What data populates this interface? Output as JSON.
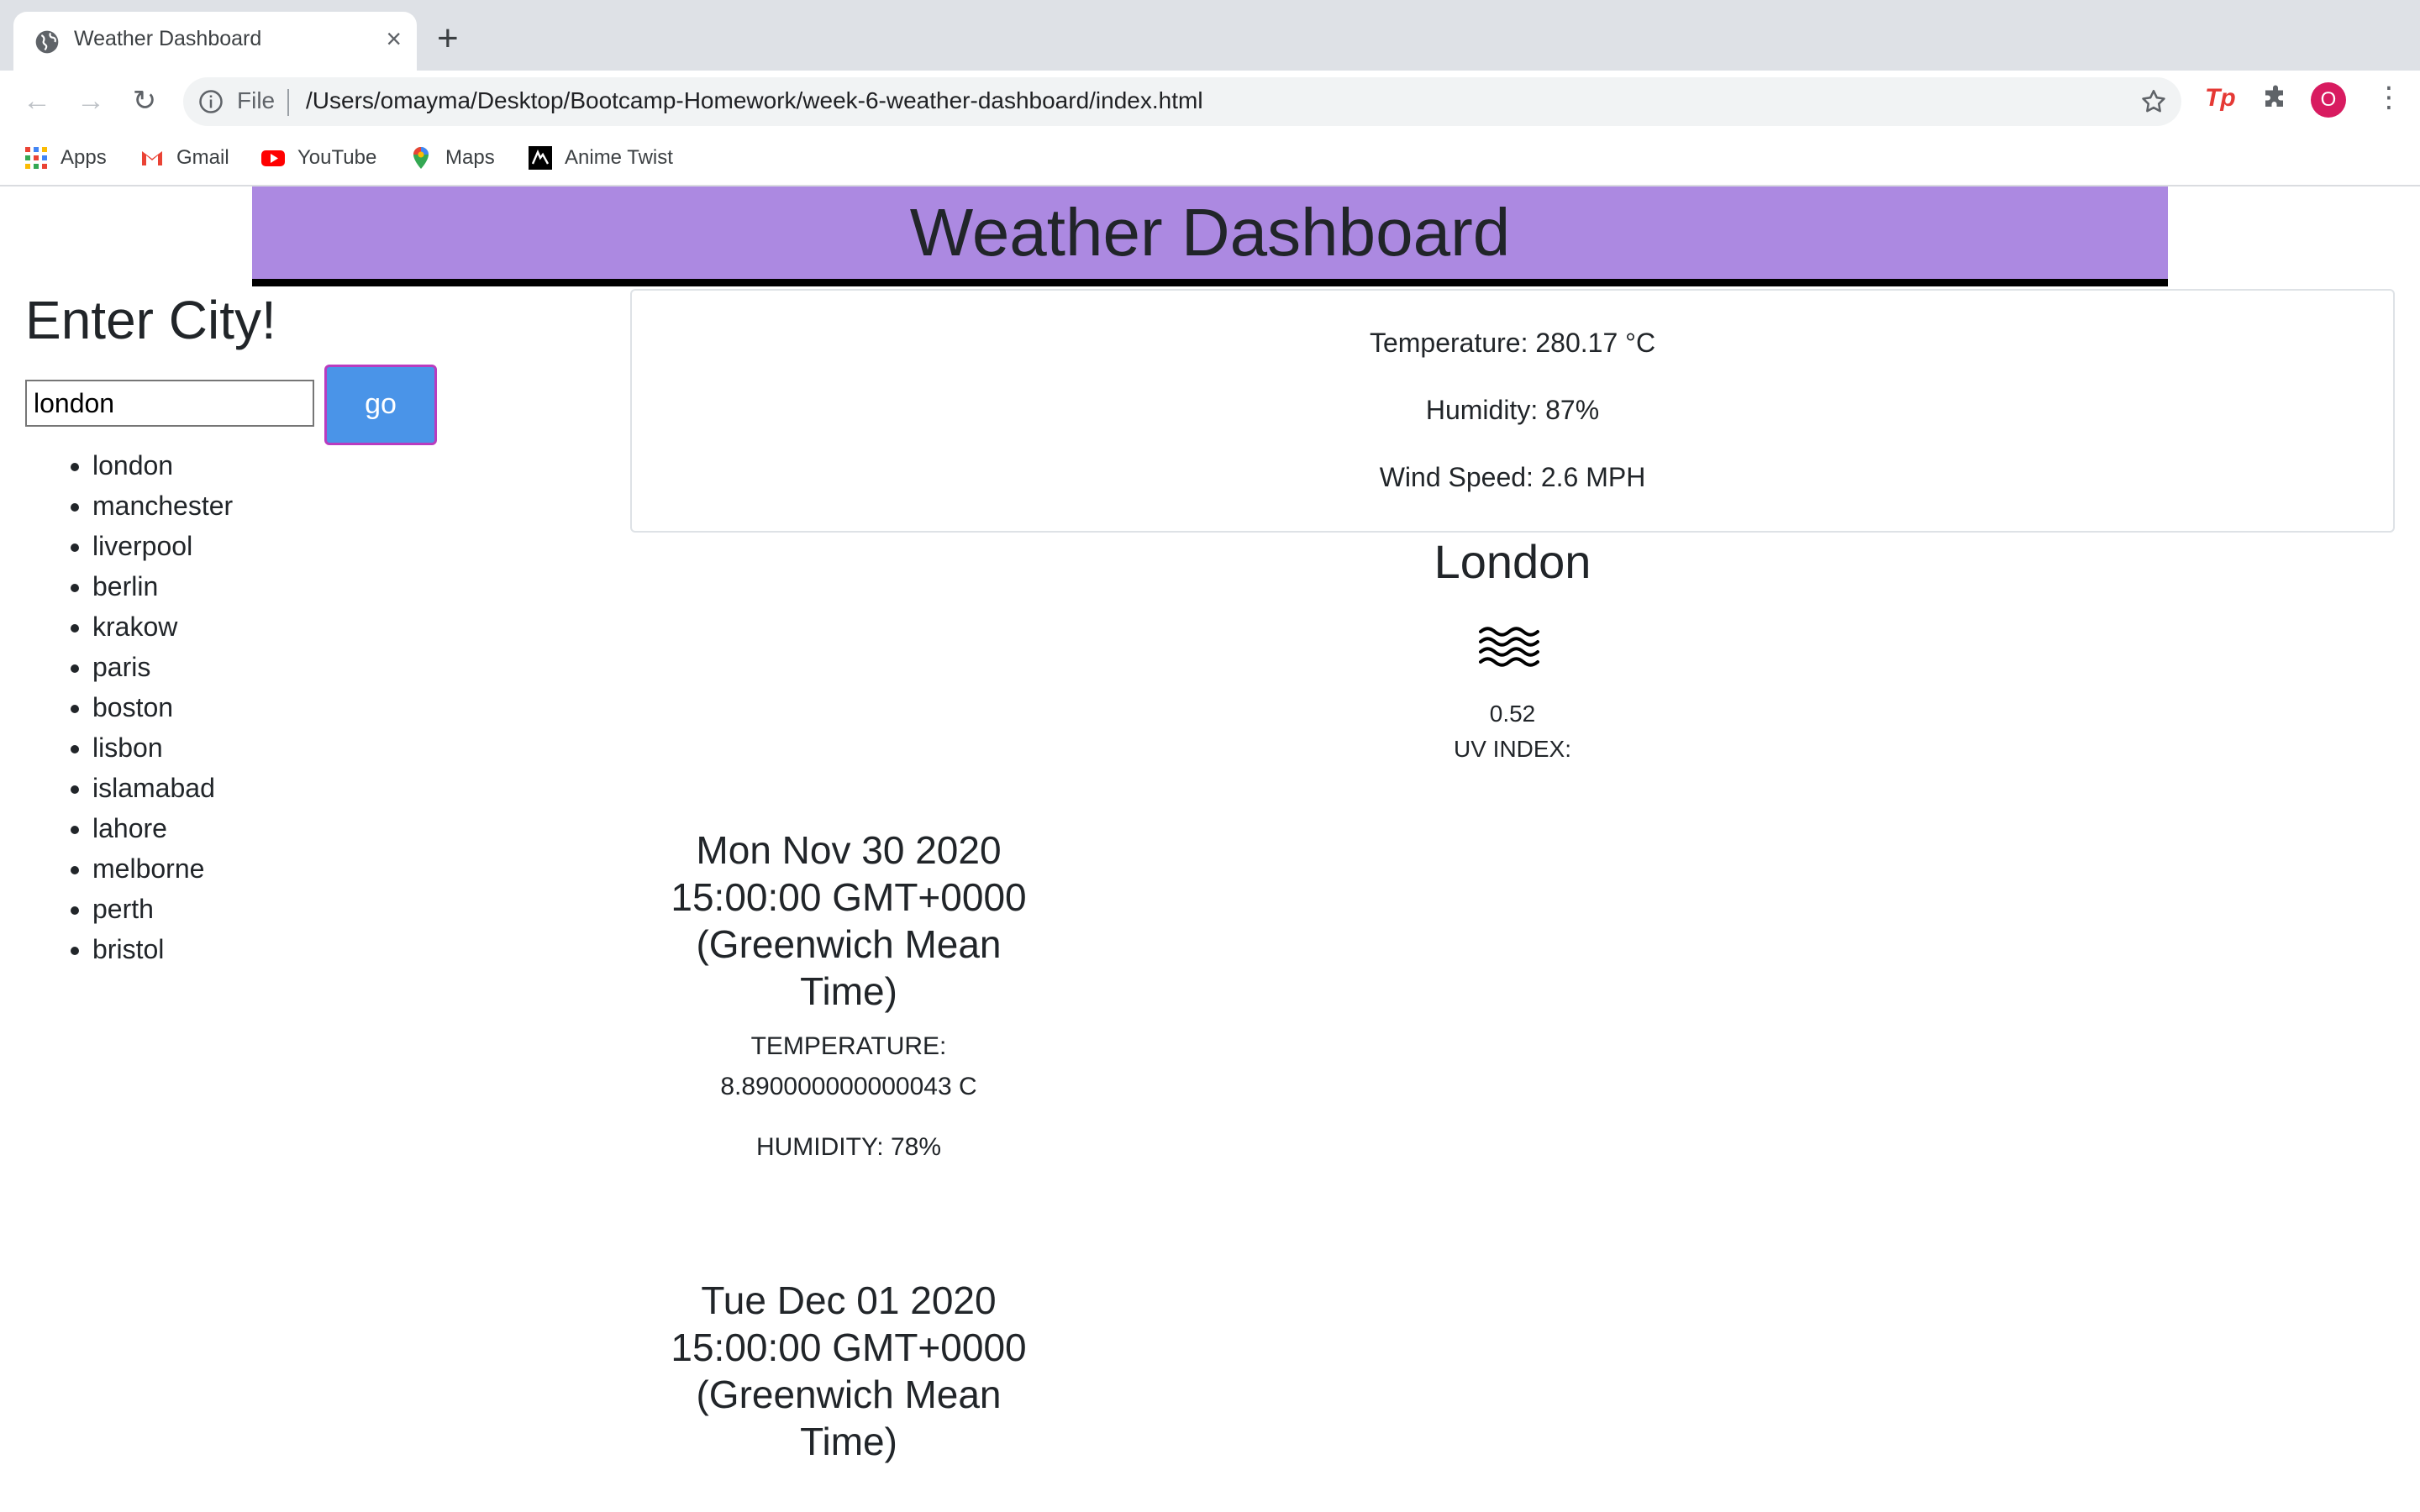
{
  "browser": {
    "tab_title": "Weather Dashboard",
    "scheme_label": "File",
    "url": "/Users/omayma/Desktop/Bootcamp-Homework/week-6-weather-dashboard/index.html",
    "profile_initial": "O",
    "extension_label": "Tp",
    "bookmarks": [
      {
        "label": "Apps",
        "icon": "apps-grid-icon"
      },
      {
        "label": "Gmail",
        "icon": "gmail-icon"
      },
      {
        "label": "YouTube",
        "icon": "youtube-icon"
      },
      {
        "label": "Maps",
        "icon": "maps-icon"
      },
      {
        "label": "Anime Twist",
        "icon": "anime-twist-icon"
      }
    ]
  },
  "header": {
    "title": "Weather Dashboard"
  },
  "sidebar": {
    "title": "Enter City!",
    "input_value": "london",
    "go_label": "go",
    "cities": [
      "london",
      "manchester",
      "liverpool",
      "berlin",
      "krakow",
      "paris",
      "boston",
      "lisbon",
      "islamabad",
      "lahore",
      "melborne",
      "perth",
      "bristol"
    ]
  },
  "current": {
    "temperature": "Temperature: 280.17 °C",
    "humidity": "Humidity: 87%",
    "wind": "Wind Speed: 2.6 MPH",
    "city": "London",
    "weather_icon": "wind-waves-icon",
    "uv_value": "0.52",
    "uv_label": "UV INDEX:"
  },
  "forecast": [
    {
      "date": "Mon Nov 30 2020 15:00:00 GMT+0000 (Greenwich Mean Time)",
      "temperature": "TEMPERATURE: 8.890000000000043 C",
      "humidity": "HUMIDITY: 78%"
    },
    {
      "date": "Tue Dec 01 2020 15:00:00 GMT+0000 (Greenwich Mean Time)"
    }
  ],
  "colors": {
    "header_bg": "#ac89e1",
    "go_button": "#4a94e8",
    "go_border": "#b93cbf"
  }
}
